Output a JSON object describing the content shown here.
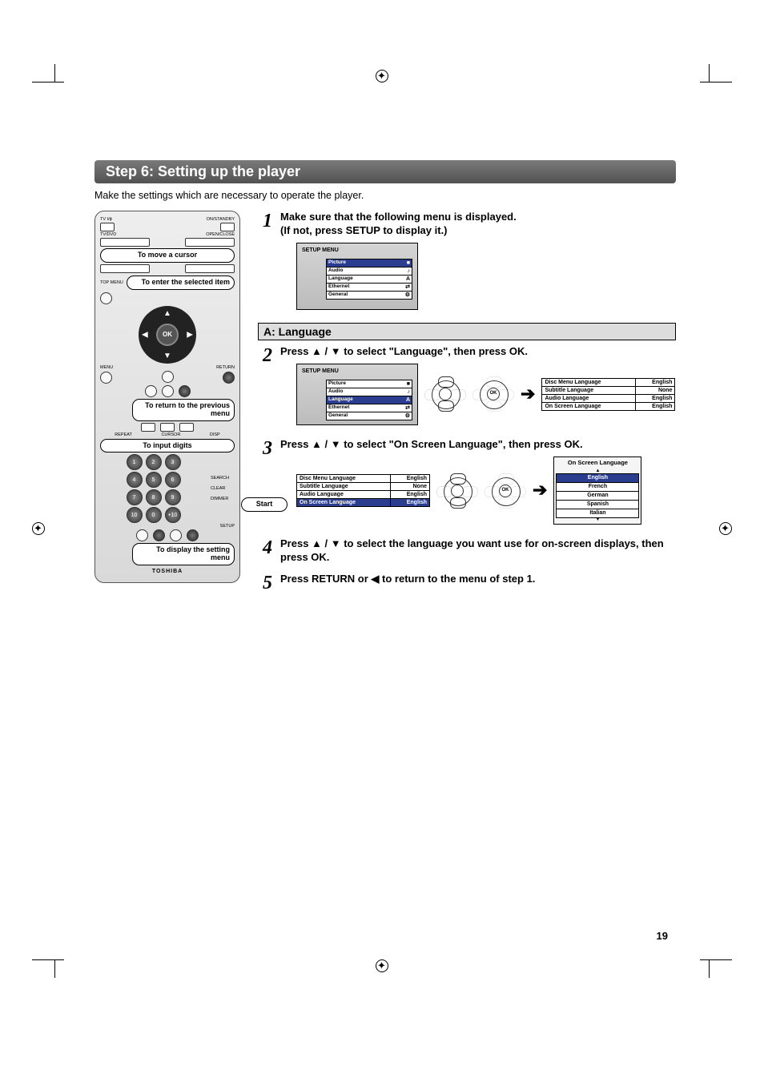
{
  "page_number": "19",
  "header": "Step 6: Setting up the player",
  "intro": "Make the settings which are necessary to operate the player.",
  "remote": {
    "top_labels": {
      "left": "TV I/ɸ",
      "right": "ON/STANDBY"
    },
    "row2_labels": {
      "left": "TV/DVD",
      "right": "OPEN/CLOSE"
    },
    "callouts": {
      "move_cursor": "To move a cursor",
      "enter": "To enter the selected item",
      "return": "To return to the previous menu",
      "digits": "To input digits",
      "start": "Start",
      "display": "To display the setting menu"
    },
    "left_labels": {
      "topmenu": "TOP MENU",
      "menu": "MENU",
      "return": "RETURN",
      "repeat": "REPEAT",
      "cursor": "CURSOR",
      "disp": "DISP",
      "setup": "SETUP"
    },
    "ok": "OK",
    "side_labels": {
      "search": "SEARCH",
      "clear": "CLEAR",
      "dimmer": "DIMMER"
    },
    "numbers": [
      "1",
      "2",
      "3",
      "4",
      "5",
      "6",
      "7",
      "8",
      "9",
      "10",
      "0",
      "+10"
    ],
    "brand": "TOSHIBA"
  },
  "section_a": "A: Language",
  "steps": {
    "s1a": "Make sure that the following menu is displayed.",
    "s1b": "(If not, press SETUP to display it.)",
    "s2": "Press ▲ / ▼ to select \"Language\", then press OK.",
    "s3": "Press ▲ / ▼ to select \"On Screen Language\", then press OK.",
    "s4": "Press ▲ / ▼ to select the language you want use for on-screen displays, then press OK.",
    "s5": "Press RETURN or ◀ to return to the menu of step 1."
  },
  "setup_menu": {
    "title": "SETUP MENU",
    "items": [
      {
        "label": "Picture",
        "icon": "■",
        "sel": true
      },
      {
        "label": "Audio",
        "icon": "♪",
        "sel": false
      },
      {
        "label": "Language",
        "icon": "A",
        "sel": false
      },
      {
        "label": "Ethernet",
        "icon": "⇄",
        "sel": false
      },
      {
        "label": "General",
        "icon": "⚙",
        "sel": false
      }
    ],
    "items2_sel": 2
  },
  "lang_table": {
    "rows": [
      {
        "k": "Disc Menu Language",
        "v": "English",
        "sel": false
      },
      {
        "k": "Subtitle Language",
        "v": "None",
        "sel": false
      },
      {
        "k": "Audio Language",
        "v": "English",
        "sel": false
      },
      {
        "k": "On Screen Language",
        "v": "English",
        "sel": false
      }
    ],
    "rows3_sel": 3
  },
  "osl_box": {
    "title": "On Screen Language",
    "options": [
      "English",
      "French",
      "German",
      "Spanish",
      "Italian"
    ],
    "selected": 0
  },
  "ctl_ok": "OK"
}
